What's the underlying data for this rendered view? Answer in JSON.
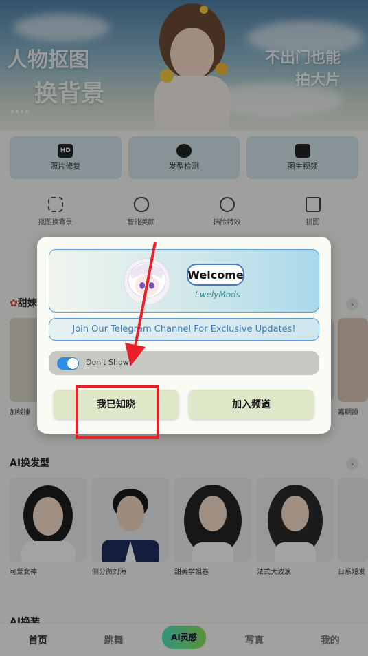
{
  "banner": {
    "left_line1": "人物抠图",
    "left_line2": "换背景",
    "right_line1": "不出门也能",
    "right_line2": "拍大片"
  },
  "feature_cards": [
    {
      "label": "照片修复",
      "icon": "hd-icon",
      "icon_text": "HD"
    },
    {
      "label": "发型检测",
      "icon": "hair-face-icon",
      "icon_text": ""
    },
    {
      "label": "图生视频",
      "icon": "video-clapper-icon",
      "icon_text": ""
    }
  ],
  "tools": [
    {
      "label": "抠图换背景",
      "icon": "cutout-icon"
    },
    {
      "label": "智能美颜",
      "icon": "face-beauty-icon"
    },
    {
      "label": "挡脸特效",
      "icon": "face-mask-icon"
    },
    {
      "label": "拼图",
      "icon": "collage-icon"
    }
  ],
  "section_sweet": {
    "title": "甜妹",
    "items": [
      {
        "caption": "加绒捶"
      },
      {
        "caption": ""
      },
      {
        "caption": ""
      },
      {
        "caption": ""
      },
      {
        "caption": "嘉糊捶"
      }
    ]
  },
  "section_hair": {
    "title": "AI换发型",
    "items": [
      {
        "caption": "可爱女神"
      },
      {
        "caption": "侧分微刘海"
      },
      {
        "caption": "甜美学姐卷"
      },
      {
        "caption": "法式大波浪"
      },
      {
        "caption": "日系短发"
      }
    ]
  },
  "section_outfit": {
    "title": "AI换装"
  },
  "bottom_nav": [
    {
      "label": "首页",
      "active": true
    },
    {
      "label": "跳舞",
      "active": false
    },
    {
      "label": "AI灵感",
      "active": false,
      "center": true
    },
    {
      "label": "写真",
      "active": false
    },
    {
      "label": "我的",
      "active": false
    }
  ],
  "dialog": {
    "welcome": "Welcome",
    "author": "LwelyMods",
    "telegram": "Join Our Telegram Channel For Exclusive Updates!",
    "dont_show": "Don't Show",
    "dont_show_enabled": true,
    "ack_button": "我已知晓",
    "join_button": "加入频道"
  },
  "colors": {
    "accent_blue": "#2e8ee6",
    "annotation_red": "#e8202a",
    "button_bg": "#dfe7c9"
  }
}
